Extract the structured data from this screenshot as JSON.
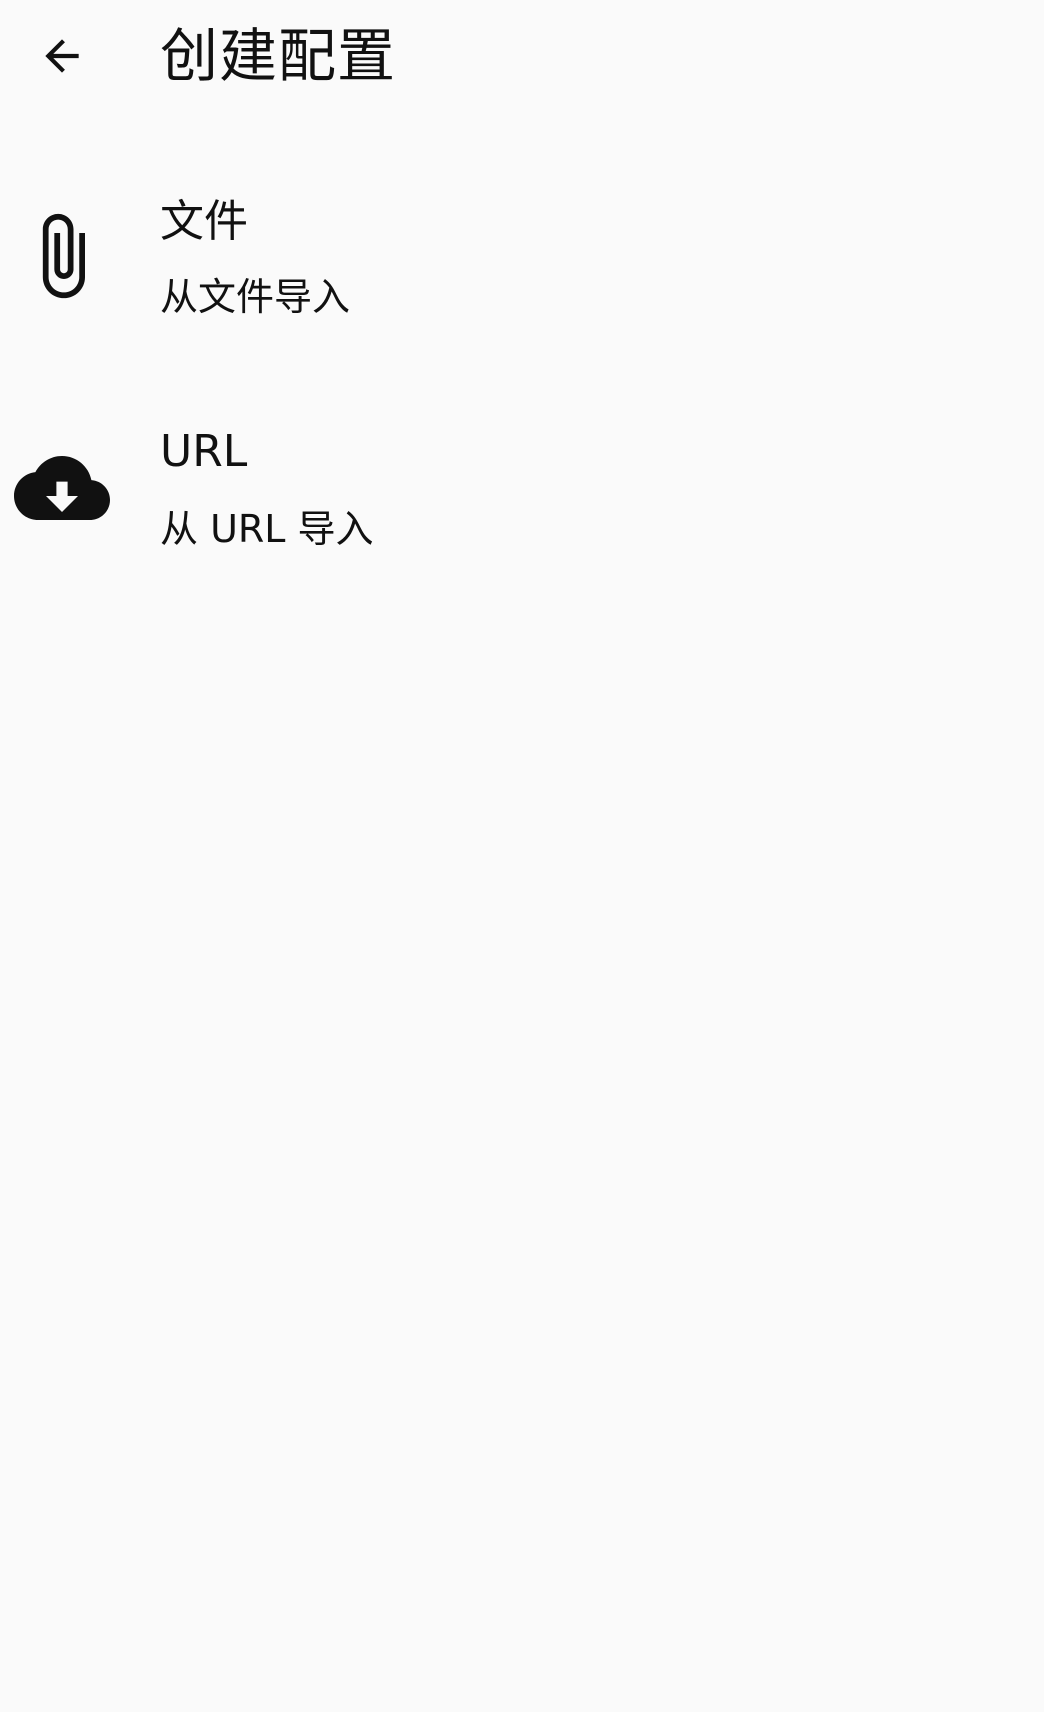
{
  "header": {
    "back_icon": "arrow-back-icon",
    "title": "创建配置"
  },
  "options": [
    {
      "icon": "paperclip-icon",
      "title": "文件",
      "subtitle": "从文件导入"
    },
    {
      "icon": "cloud-download-icon",
      "title": "URL",
      "subtitle": "从 URL 导入"
    }
  ],
  "colors": {
    "background": "#fafafa",
    "text": "#111111",
    "icon": "#111111"
  }
}
